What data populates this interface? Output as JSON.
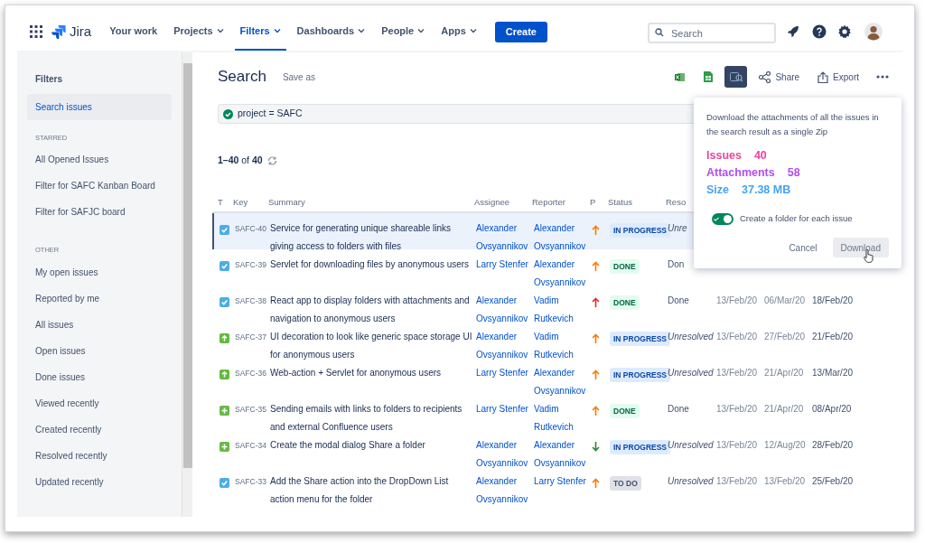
{
  "nav": {
    "product": "Jira",
    "items": [
      {
        "label": "Your work",
        "dropdown": false,
        "selected": false
      },
      {
        "label": "Projects",
        "dropdown": true,
        "selected": false
      },
      {
        "label": "Filters",
        "dropdown": true,
        "selected": true
      },
      {
        "label": "Dashboards",
        "dropdown": true,
        "selected": false
      },
      {
        "label": "People",
        "dropdown": true,
        "selected": false
      },
      {
        "label": "Apps",
        "dropdown": true,
        "selected": false
      }
    ],
    "create": "Create",
    "search": {
      "placeholder": "Search"
    }
  },
  "sidebar": {
    "title": "Filters",
    "items": [
      {
        "label": "Search issues",
        "selected": true
      }
    ],
    "sections": [
      {
        "heading": "STARRED",
        "items": [
          {
            "label": "All Opened Issues",
            "selected": false
          },
          {
            "label": "Filter for SAFC Kanban Board",
            "selected": false
          },
          {
            "label": "Filter for SAFJC board",
            "selected": false
          }
        ]
      },
      {
        "heading": "OTHER",
        "items": [
          {
            "label": "My open issues",
            "selected": false
          },
          {
            "label": "Reported by me",
            "selected": false
          },
          {
            "label": "All issues",
            "selected": false
          },
          {
            "label": "Open issues",
            "selected": false
          },
          {
            "label": "Done issues",
            "selected": false
          },
          {
            "label": "Viewed recently",
            "selected": false
          },
          {
            "label": "Created recently",
            "selected": false
          },
          {
            "label": "Resolved recently",
            "selected": false
          },
          {
            "label": "Updated recently",
            "selected": false
          }
        ]
      }
    ]
  },
  "page": {
    "title": "Search",
    "save_as": "Save as",
    "toolbar": [
      {
        "kind": "excel",
        "active": false
      },
      {
        "kind": "sheet",
        "active": false
      },
      {
        "kind": "attachments",
        "active": true
      },
      {
        "kind": "share",
        "label": "Share",
        "active": false
      },
      {
        "kind": "export",
        "label": "Export",
        "active": false
      },
      {
        "kind": "more",
        "active": false
      }
    ],
    "query": {
      "valid": true,
      "text": "project = SAFC"
    },
    "count": "**1–40** of **40**"
  },
  "table": {
    "columns": [
      "T",
      "Key",
      "Summary",
      "Assignee",
      "Reporter",
      "P",
      "Status",
      "Reso"
    ],
    "rows": [
      {
        "type": {
          "kind": "task"
        },
        "key": "SAFC-40",
        "summary": "Service for generating unique shareable links giving access to folders with files",
        "assignee": "Alexander Ovsyannikov",
        "reporter": "Alexander Ovsyannikov",
        "priority": {
          "kind": "high"
        },
        "status": {
          "label": "IN PROGRESS",
          "kind": "in_progress"
        },
        "resolution": "Unre",
        "unresolved": true,
        "selected": true
      },
      {
        "type": {
          "kind": "task"
        },
        "key": "SAFC-39",
        "summary": "Servlet for downloading files by anonymous users",
        "assignee": "Larry Stenfer",
        "reporter": "Alexander Ovsyannikov",
        "priority": {
          "kind": "high"
        },
        "status": {
          "label": "DONE",
          "kind": "done"
        },
        "resolution": "Don",
        "unresolved": false,
        "selected": false
      },
      {
        "type": {
          "kind": "task"
        },
        "key": "SAFC-38",
        "summary": "React app to display folders with attachments and navigation to anonymous users",
        "assignee": "Alexander Ovsyannikov",
        "reporter": "Vadim Rutkevich",
        "priority": {
          "kind": "highest"
        },
        "status": {
          "label": "DONE",
          "kind": "done"
        },
        "resolution": "Done",
        "unresolved": false,
        "created": "13/Feb/20",
        "updated": "06/Mar/20",
        "due": "18/Feb/20",
        "selected": false
      },
      {
        "type": {
          "kind": "improvement"
        },
        "key": "SAFC-37",
        "summary": "UI decoration to look like generic space storage UI for anonymous users",
        "assignee": "Alexander Ovsyannikov",
        "reporter": "Vadim Rutkevich",
        "priority": {
          "kind": "high"
        },
        "status": {
          "label": "IN PROGRESS",
          "kind": "in_progress"
        },
        "resolution": "Unresolved",
        "unresolved": true,
        "created": "13/Feb/20",
        "updated": "27/Feb/20",
        "due": "21/Feb/20",
        "selected": false
      },
      {
        "type": {
          "kind": "improvement"
        },
        "key": "SAFC-36",
        "summary": "Web-action + Servlet for anonymous users",
        "assignee": "Larry Stenfer",
        "reporter": "Alexander Ovsyannikov",
        "priority": {
          "kind": "high"
        },
        "status": {
          "label": "IN PROGRESS",
          "kind": "in_progress"
        },
        "resolution": "Unresolved",
        "unresolved": true,
        "created": "13/Feb/20",
        "updated": "21/Apr/20",
        "due": "13/Mar/20",
        "selected": false
      },
      {
        "type": {
          "kind": "feature"
        },
        "key": "SAFC-35",
        "summary": "Sending emails with links to folders to recipients and external Confluence users",
        "assignee": "Larry Stenfer",
        "reporter": "Vadim Rutkevich",
        "priority": {
          "kind": "high"
        },
        "status": {
          "label": "DONE",
          "kind": "done"
        },
        "resolution": "Done",
        "unresolved": false,
        "created": "13/Feb/20",
        "updated": "21/Apr/20",
        "due": "08/Apr/20",
        "selected": false
      },
      {
        "type": {
          "kind": "feature"
        },
        "key": "SAFC-34",
        "summary": "Create the modal dialog Share a folder",
        "assignee": "Alexander Ovsyannikov",
        "reporter": "Alexander Ovsyannikov",
        "priority": {
          "kind": "low"
        },
        "status": {
          "label": "IN PROGRESS",
          "kind": "in_progress"
        },
        "resolution": "Unresolved",
        "unresolved": true,
        "created": "13/Feb/20",
        "updated": "12/Aug/20",
        "due": "28/Feb/20",
        "selected": false
      },
      {
        "type": {
          "kind": "task"
        },
        "key": "SAFC-33",
        "summary": "Add the Share action into the DropDown List action menu for the folder",
        "assignee": "Alexander Ovsyannikov",
        "reporter": "Larry Stenfer",
        "priority": {
          "kind": "high"
        },
        "status": {
          "label": "TO DO",
          "kind": "todo"
        },
        "resolution": "Unresolved",
        "unresolved": true,
        "created": "13/Feb/20",
        "updated": "13/Feb/20",
        "due": "25/Feb/20",
        "selected": false
      }
    ]
  },
  "popover": {
    "description": "Download the attachments of all the issues in the search result as a single Zip",
    "stats": [
      {
        "label": "Issues",
        "value": "40",
        "color": "#e8459c"
      },
      {
        "label": "Attachments",
        "value": "58",
        "color": "#b14ef0"
      },
      {
        "label": "Size",
        "value": "37.38 MB",
        "color": "#47a3f3"
      }
    ],
    "toggle": {
      "label": "Create a folder for each issue",
      "on": true
    },
    "buttons": [
      {
        "label": "Cancel",
        "kind": "subtle",
        "hovered": false
      },
      {
        "label": "Download",
        "kind": "default",
        "hovered": true
      }
    ]
  }
}
